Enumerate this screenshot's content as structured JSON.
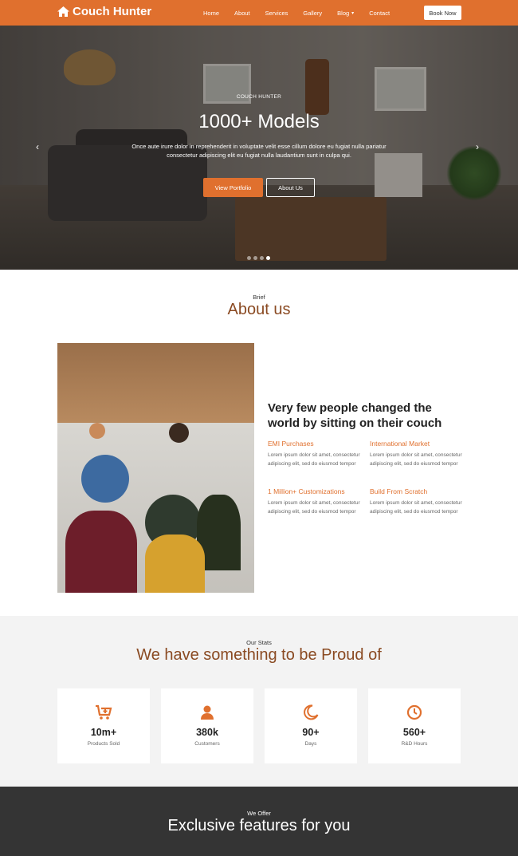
{
  "brand": {
    "name": "Couch Hunter",
    "icon": "home-icon"
  },
  "nav": {
    "items": [
      "Home",
      "About",
      "Services",
      "Gallery",
      "Blog",
      "Contact"
    ],
    "book_label": "Book Now"
  },
  "hero": {
    "eyebrow": "COUCH HUNTER",
    "title": "1000+ Models",
    "text": "Once aute irure dolor in reprehenderit in voluptate velit esse cillum dolore eu fugiat nulla pariatur consectetur adipiscing elit eu fugiat nulla laudantium sunt in culpa qui.",
    "primary_btn": "View Portfolio",
    "secondary_btn": "About Us",
    "slides": 4,
    "active_slide": 4
  },
  "about": {
    "eyebrow": "Brief",
    "title": "About us",
    "heading": "Very few people changed the world by sitting on their couch",
    "features": [
      {
        "title": "EMI Purchases",
        "text": "Lorem ipsum dolor sit amet, consectetur adipiscing elit, sed do eiusmod tempor"
      },
      {
        "title": "International Market",
        "text": "Lorem ipsum dolor sit amet, consectetur adipiscing elit, sed do eiusmod tempor"
      },
      {
        "title": "1 Million+ Customizations",
        "text": "Lorem ipsum dolor sit amet, consectetur adipiscing elit, sed do eiusmod tempor"
      },
      {
        "title": "Build From Scratch",
        "text": "Lorem ipsum dolor sit amet, consectetur adipiscing elit, sed do eiusmod tempor"
      }
    ]
  },
  "stats": {
    "eyebrow": "Our Stats",
    "title": "We have something to be Proud of",
    "items": [
      {
        "icon": "cart-plus-icon",
        "value": "10m+",
        "label": "Products Sold"
      },
      {
        "icon": "user-icon",
        "value": "380k",
        "label": "Customers"
      },
      {
        "icon": "moon-icon",
        "value": "90+",
        "label": "Days"
      },
      {
        "icon": "clock-icon",
        "value": "560+",
        "label": "R&D Hours"
      }
    ]
  },
  "offer": {
    "eyebrow": "We Offer",
    "title": "Exclusive features for you"
  },
  "colors": {
    "accent": "#e0702e",
    "title_brown": "#8a4a22",
    "dark": "#343434"
  }
}
